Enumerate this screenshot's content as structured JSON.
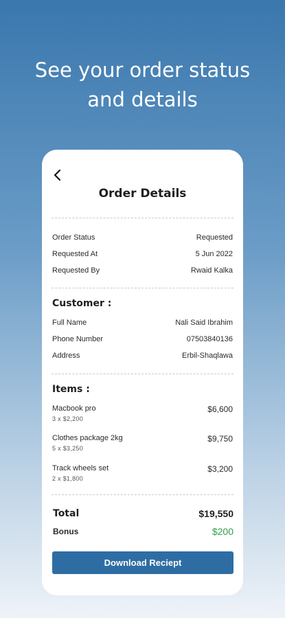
{
  "promo": {
    "headline_line1": "See your order status",
    "headline_line2": "and details"
  },
  "header": {
    "back_icon": "chevron-left-icon",
    "title": "Order Details"
  },
  "order": {
    "status_label": "Order Status",
    "status_value": "Requested",
    "requested_at_label": "Requested At",
    "requested_at_value": "5 Jun 2022",
    "requested_by_label": "Requested By",
    "requested_by_value": "Rwaid Kalka"
  },
  "customer": {
    "section_title": "Customer  :",
    "full_name_label": "Full Name",
    "full_name_value": "Nali Said Ibrahim",
    "phone_label": "Phone Number",
    "phone_value": "07503840136",
    "address_label": "Address",
    "address_value": "Erbil-Shaqlawa"
  },
  "items": {
    "section_title": "Items :",
    "list": [
      {
        "name": "Macbook pro",
        "qty": "3 x $2,200",
        "price": "$6,600"
      },
      {
        "name": "Clothes package 2kg",
        "qty": "5 x $3,250",
        "price": "$9,750"
      },
      {
        "name": "Track wheels set",
        "qty": "2 x $1,800",
        "price": "$3,200"
      }
    ]
  },
  "totals": {
    "total_label": "Total",
    "total_value": "$19,550",
    "bonus_label": "Bonus",
    "bonus_value": "$200"
  },
  "actions": {
    "download_label": "Download Reciept"
  },
  "colors": {
    "accent": "#2e6da3",
    "bonus_green": "#2e9e46",
    "background_top": "#3a77ad"
  }
}
